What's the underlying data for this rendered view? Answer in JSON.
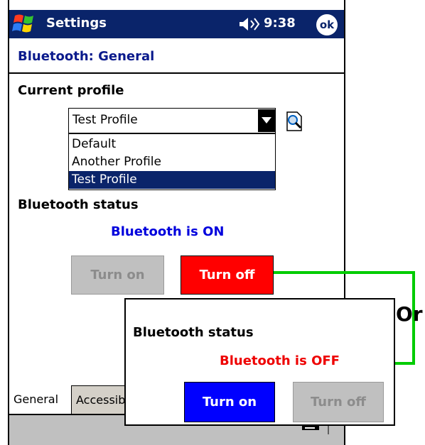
{
  "titlebar": {
    "title": "Settings",
    "time": "9:38",
    "ok_label": "ok"
  },
  "page_header": "Bluetooth: General",
  "current_profile": {
    "label": "Current profile",
    "selected": "Test Profile",
    "options": [
      "Default",
      "Another Profile",
      "Test Profile"
    ]
  },
  "status_on_panel": {
    "label": "Bluetooth status",
    "status_text": "Bluetooth is ON",
    "turn_on_label": "Turn on",
    "turn_off_label": "Turn off"
  },
  "status_off_panel": {
    "label": "Bluetooth status",
    "status_text": "Bluetooth is OFF",
    "turn_on_label": "Turn on",
    "turn_off_label": "Turn off"
  },
  "tabs": {
    "general": "General",
    "accessibility": "Accessibility"
  },
  "connector_label": "Or",
  "colors": {
    "titlebar": "#0a246a",
    "header_text": "#0a1a8c",
    "status_on": "#0000dd",
    "status_off": "#ee0000",
    "turn_off_active": "#ff0000",
    "turn_on_active": "#0000ff",
    "disabled_button": "#c0c0c0",
    "connector": "#00cc00"
  },
  "icons": {
    "start": "windows-flag-icon",
    "speaker": "speaker-icon",
    "profile_action": "magnifier-icon",
    "keyboard": "keyboard-icon",
    "sip_arrow": "up-arrow-icon"
  }
}
